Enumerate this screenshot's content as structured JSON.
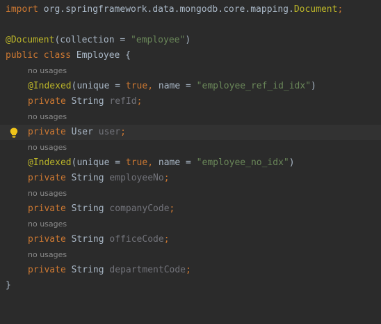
{
  "editor": {
    "line01": {
      "import_kw": "import",
      "import_path": " org.springframework.data.mongodb.core.mapping.",
      "import_class": "Document",
      "semicolon": ";"
    },
    "line03": {
      "annotation": "@Document",
      "open": "(collection = ",
      "value": "\"employee\"",
      "close": ")"
    },
    "line04": {
      "public_kw": "public",
      "class_kw": "class",
      "class_name": "Employee",
      "brace": "{"
    },
    "hints": {
      "h1": "no usages",
      "h2": "no usages",
      "h3": "no usages",
      "h4": "no usages",
      "h5": "no usages",
      "h6": "no usages"
    },
    "idx1": {
      "annotation": "@Indexed",
      "p1": "(unique = ",
      "bool": "true",
      "comma": ",",
      "p2": " name = ",
      "value": "\"employee_ref_id_idx\"",
      "close": ")"
    },
    "f_refid": {
      "modifier": "private",
      "type": "String",
      "name": "refId",
      "semi": ";"
    },
    "f_user": {
      "modifier": "private",
      "type": "User",
      "name": "user",
      "semi": ";"
    },
    "idx2": {
      "annotation": "@Indexed",
      "p1": "(unique = ",
      "bool": "true",
      "comma": ",",
      "p2": " name = ",
      "value": "\"employee_no_idx\"",
      "close": ")"
    },
    "f_employeeno": {
      "modifier": "private",
      "type": "String",
      "name": "employeeNo",
      "semi": ";"
    },
    "f_companycode": {
      "modifier": "private",
      "type": "String",
      "name": "companyCode",
      "semi": ";"
    },
    "f_officecode": {
      "modifier": "private",
      "type": "String",
      "name": "officeCode",
      "semi": ";"
    },
    "f_departmentcode": {
      "modifier": "private",
      "type": "String",
      "name": "departmentCode",
      "semi": ";"
    },
    "closing_brace": "}"
  },
  "colors": {
    "background": "#2b2b2b",
    "current_line": "#323232",
    "keyword": "#cc7832",
    "annotation": "#bbb529",
    "string": "#6a8759",
    "field": "#9876aa",
    "unused_field": "#72737a",
    "default_text": "#a9b7c6",
    "inlay_hint": "#8a8a8a",
    "bulb": "#f0c419"
  },
  "icons": {
    "intention": "lightbulb-icon"
  }
}
